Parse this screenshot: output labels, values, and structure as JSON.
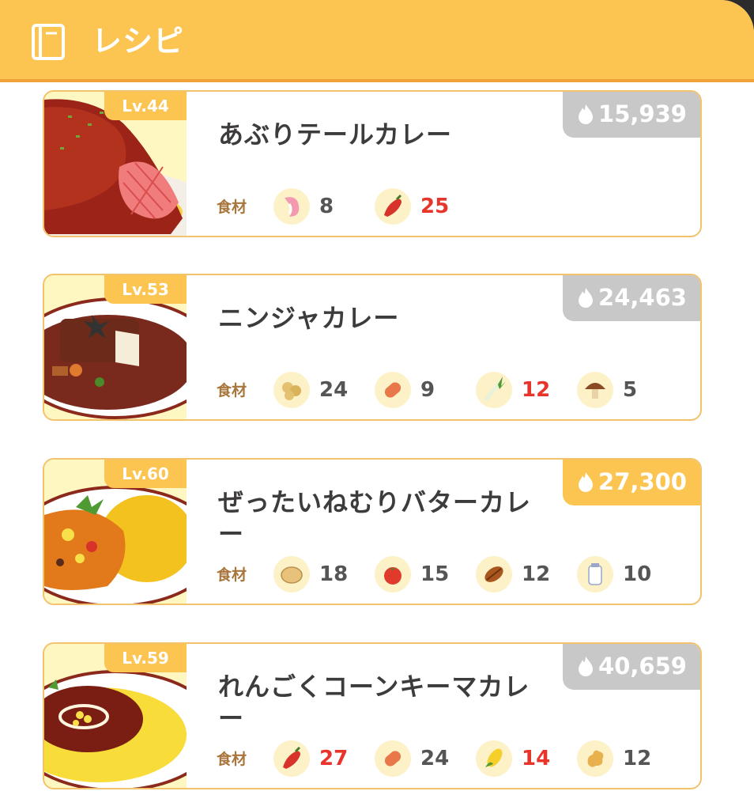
{
  "header": {
    "title": "レシピ",
    "icon": "book-icon"
  },
  "ingredient_label": "食材",
  "recipes": [
    {
      "level": "Lv.44",
      "name": "あぶりテールカレー",
      "strength": "15,939",
      "highlight": false,
      "ingredients": [
        {
          "icon": "tail-icon",
          "count": "8",
          "short": false
        },
        {
          "icon": "pepper-icon",
          "count": "25",
          "short": true
        }
      ]
    },
    {
      "level": "Lv.53",
      "name": "ニンジャカレー",
      "strength": "24,463",
      "highlight": false,
      "ingredients": [
        {
          "icon": "soybean-icon",
          "count": "24",
          "short": false
        },
        {
          "icon": "sausage-icon",
          "count": "9",
          "short": false
        },
        {
          "icon": "leek-icon",
          "count": "12",
          "short": true
        },
        {
          "icon": "mushroom-icon",
          "count": "5",
          "short": false
        }
      ]
    },
    {
      "level": "Lv.60",
      "name": "ぜったいねむりバターカレー",
      "strength": "27,300",
      "highlight": true,
      "ingredients": [
        {
          "icon": "potato-icon",
          "count": "18",
          "short": false
        },
        {
          "icon": "tomato-icon",
          "count": "15",
          "short": false
        },
        {
          "icon": "cacao-icon",
          "count": "12",
          "short": false
        },
        {
          "icon": "milk-icon",
          "count": "10",
          "short": false
        }
      ]
    },
    {
      "level": "Lv.59",
      "name": "れんごくコーンキーマカレー",
      "strength": "40,659",
      "highlight": false,
      "ingredients": [
        {
          "icon": "pepper-icon",
          "count": "27",
          "short": true
        },
        {
          "icon": "sausage-icon",
          "count": "24",
          "short": false
        },
        {
          "icon": "corn-icon",
          "count": "14",
          "short": true
        },
        {
          "icon": "ginger-icon",
          "count": "12",
          "short": false
        }
      ]
    }
  ],
  "colors": {
    "header": "#fcc451",
    "header_border": "#f0a238",
    "badge_gray": "#c8c8c8",
    "shortage_red": "#e8352b",
    "ingredient_label": "#a8763d"
  }
}
